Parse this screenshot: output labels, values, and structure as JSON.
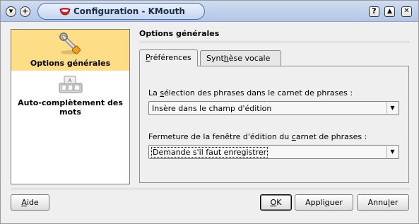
{
  "window": {
    "title": "Configuration - KMouth",
    "menu_button": "▾",
    "sticky_button": "+",
    "help_button": "?",
    "shade_button": "▲",
    "close_button": "✕"
  },
  "sidebar": {
    "items": [
      {
        "label": "Options générales",
        "icon": "wrench-icon",
        "selected": true
      },
      {
        "label": "Auto-complètement des mots",
        "icon": "keyboard-icon",
        "selected": false
      }
    ]
  },
  "page": {
    "title": "Options générales",
    "tabs": [
      {
        "label_pre": "",
        "label_u": "P",
        "label_post": "références",
        "active": true
      },
      {
        "label_pre": "Synt",
        "label_u": "h",
        "label_post": "èse vocale",
        "active": false
      }
    ],
    "fields": [
      {
        "label_pre": "La ",
        "label_u": "s",
        "label_post": "élection des phrases dans le carnet de phrases :",
        "value": "Insère dans le champ d'édition"
      },
      {
        "label_pre": "Fermeture de la fenêtre d'édition du ",
        "label_u": "c",
        "label_post": "arnet de phrases :",
        "value": "Demande s'il faut enregistrer"
      }
    ]
  },
  "buttons": {
    "help": {
      "u": "A",
      "rest": "ide"
    },
    "ok": {
      "u": "O",
      "rest": "K"
    },
    "apply": {
      "pre": "Appli",
      "u": "q",
      "rest": "uer"
    },
    "cancel": {
      "pre": "Annu",
      "u": "l",
      "rest": "er"
    }
  },
  "colors": {
    "selection": "#fddd86",
    "titlebar": "#b3c6e6"
  }
}
